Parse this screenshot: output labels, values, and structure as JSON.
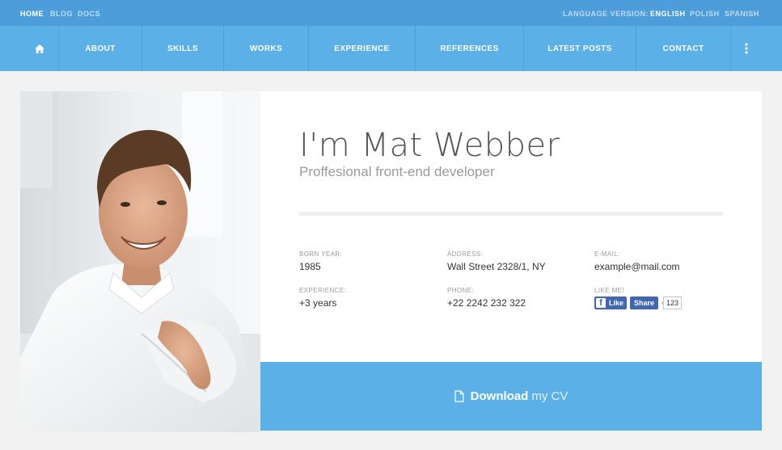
{
  "topbar": {
    "links": [
      "HOME",
      "BLOG",
      "DOCS"
    ],
    "language_label": "LANGUAGE VERSION:",
    "languages": [
      "ENGLISH",
      "POLISH",
      "SPANISH"
    ]
  },
  "nav": {
    "items": [
      "ABOUT",
      "SKILLS",
      "WORKS",
      "EXPERIENCE",
      "REFERENCES",
      "LATEST POSTS",
      "CONTACT"
    ]
  },
  "profile": {
    "name": "I'm Mat Webber",
    "subtitle": "Proffesional front-end developer",
    "born_label": "BORN YEAR:",
    "born_value": "1985",
    "address_label": "ADDRESS:",
    "address_value": "Wall Street 2328/1, NY",
    "email_label": "E-MAIL:",
    "email_value": "example@mail.com",
    "experience_label": "EXPERIENCE:",
    "experience_value": "+3 years",
    "phone_label": "PHONE:",
    "phone_value": "+22 2242 232 322",
    "like_label": "LIKE ME!"
  },
  "facebook": {
    "like_label": "Like",
    "share_label": "Share",
    "count": "123"
  },
  "download": {
    "strong": "Download",
    "light": "my CV"
  },
  "colors": {
    "topbar": "#4d9ddb",
    "navbar": "#5bb0e7",
    "accent": "#5bb0e7"
  }
}
